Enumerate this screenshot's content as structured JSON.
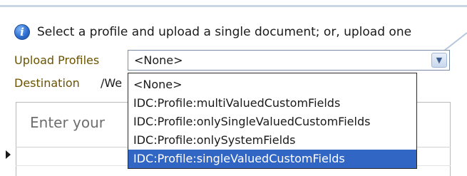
{
  "info": {
    "icon": "info-icon",
    "message": "Select a profile and upload a single document; or, upload one"
  },
  "upload_profiles": {
    "label": "Upload Profiles",
    "selected_value": "<None>",
    "arrow_icon": "chevron-down-icon",
    "options": [
      "<None>",
      "IDC:Profile:multiValuedCustomFields",
      "IDC:Profile:onlySingleValuedCustomFields",
      "IDC:Profile:onlySystemFields",
      "IDC:Profile:singleValuedCustomFields"
    ],
    "highlighted_option": "IDC:Profile:singleValuedCustomFields"
  },
  "destination": {
    "label": "Destination",
    "value": "/We"
  },
  "editor": {
    "placeholder": "Enter your"
  },
  "colors": {
    "label_color": "#6b5300",
    "highlight": "#3166c4",
    "border": "#7a8da6"
  }
}
